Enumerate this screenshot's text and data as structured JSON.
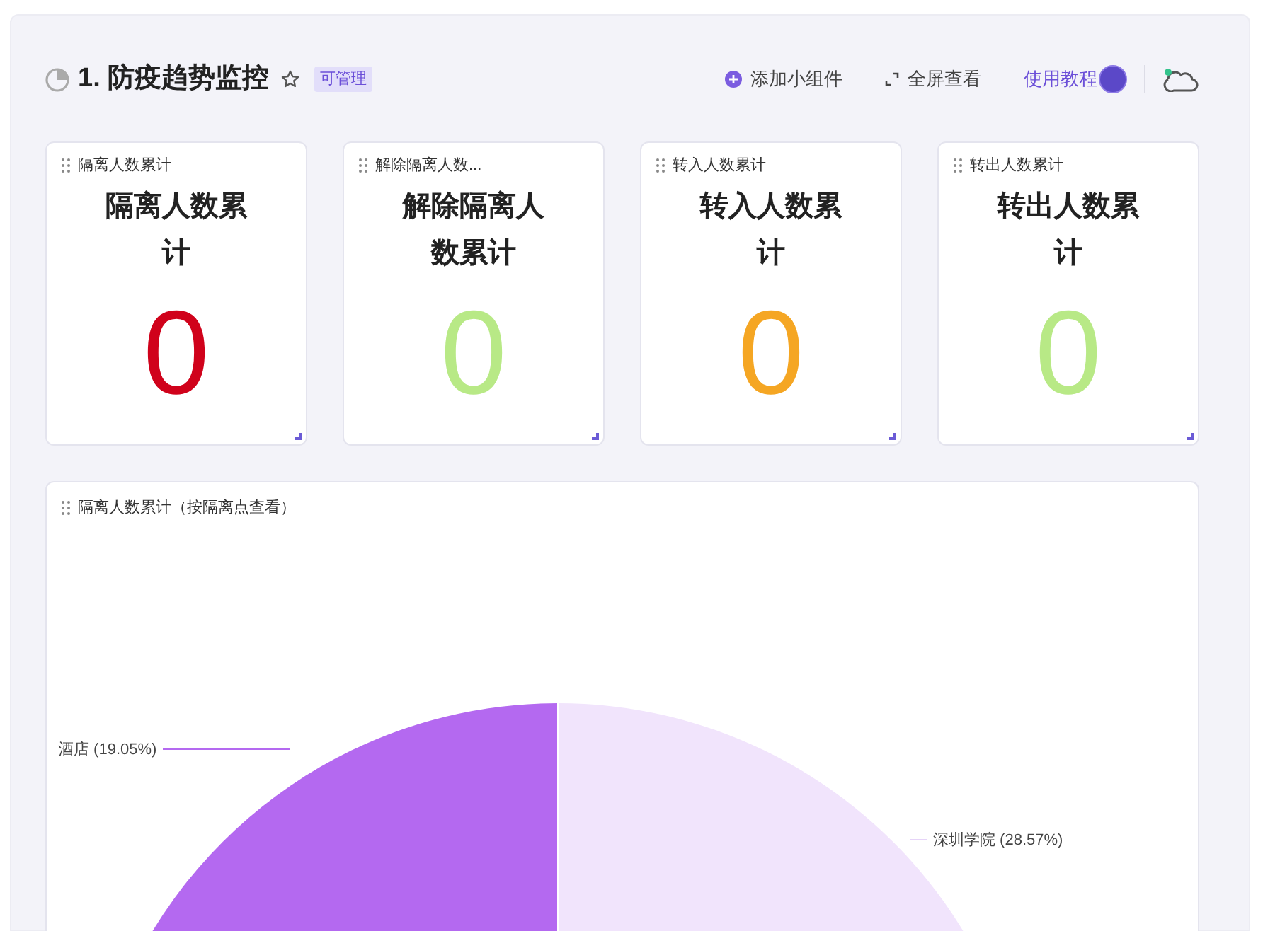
{
  "header": {
    "title": "1. 防疫趋势监控",
    "badge": "可管理",
    "actions": [
      {
        "kind": "add",
        "label": "添加小组件"
      },
      {
        "kind": "fullscreen",
        "label": "全屏查看"
      },
      {
        "kind": "tutorial",
        "label": "使用教程"
      }
    ]
  },
  "stat_cards": [
    {
      "title": "隔离人数累计",
      "heading": "隔离人数累计",
      "value": "0",
      "color": "#d0021b"
    },
    {
      "title": "解除隔离人数...",
      "heading": "解除隔离人数累计",
      "value": "0",
      "color": "#b8e986"
    },
    {
      "title": "转入人数累计",
      "heading": "转入人数累计",
      "value": "0",
      "color": "#f5a623"
    },
    {
      "title": "转出人数累计",
      "heading": "转出人数累计",
      "value": "0",
      "color": "#b8e986"
    }
  ],
  "chart_card": {
    "title": "隔离人数累计（按隔离点查看）",
    "slice_labels": [
      {
        "kind": "left",
        "text": "酒店 (19.05%)"
      },
      {
        "kind": "right",
        "text": "深圳学院 (28.57%)"
      }
    ]
  }
}
